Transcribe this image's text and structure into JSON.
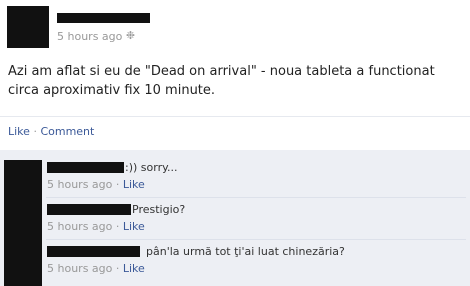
{
  "post": {
    "time": "5 hours ago",
    "settings_icon": "gear-icon",
    "text": "Azi am aflat si eu de \"Dead on arrival\" - noua tableta a functionat circa aproximativ fix 10 minute.",
    "like_label": "Like",
    "separator": "·",
    "comment_label": "Comment"
  },
  "comments": [
    {
      "text": ":)) sorry...",
      "time": "5 hours ago",
      "separator": "·",
      "like_label": "Like"
    },
    {
      "text": "Prestigio?",
      "time": "5 hours ago",
      "separator": "·",
      "like_label": "Like"
    },
    {
      "text": "pân'la urmă tot ţi'ai luat chinezăria?",
      "time": "5 hours ago",
      "separator": "·",
      "like_label": "Like"
    }
  ],
  "colors": {
    "link": "#3b5998",
    "meta": "#999999",
    "panel": "#edeff4",
    "redaction": "#111111"
  }
}
